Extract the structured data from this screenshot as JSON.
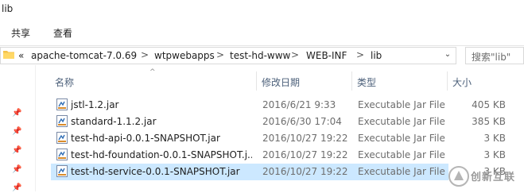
{
  "window": {
    "title": "lib"
  },
  "ribbon": {
    "tabs": [
      "共享",
      "查看"
    ]
  },
  "address": {
    "overflow": "«",
    "crumbs": [
      "apache-tomcat-7.0.69",
      "wtpwebapps",
      "test-hd-www",
      "WEB-INF",
      "lib"
    ],
    "separator": ">"
  },
  "search": {
    "placeholder": "搜索\"lib\""
  },
  "columns": {
    "name": "名称",
    "date": "修改日期",
    "type": "类型",
    "size": "大小"
  },
  "files": [
    {
      "name": "jstl-1.2.jar",
      "date": "2016/6/21 9:33",
      "type": "Executable Jar File",
      "size": "405 KB"
    },
    {
      "name": "standard-1.1.2.jar",
      "date": "2016/6/30 17:04",
      "type": "Executable Jar File",
      "size": "385 KB"
    },
    {
      "name": "test-hd-api-0.0.1-SNAPSHOT.jar",
      "date": "2016/10/27 19:22",
      "type": "Executable Jar File",
      "size": "3 KB"
    },
    {
      "name": "test-hd-foundation-0.0.1-SNAPSHOT.j...",
      "date": "2016/10/27 19:22",
      "type": "Executable Jar File",
      "size": "3 KB"
    },
    {
      "name": "test-hd-service-0.0.1-SNAPSHOT.jar",
      "date": "2016/10/27 19:22",
      "type": "Executable Jar File",
      "size": "3 KB"
    }
  ],
  "selected_row": 4,
  "watermark": {
    "text": "创新互联"
  },
  "colors": {
    "selection": "#cce8ff",
    "header_text": "#4c607a",
    "muted_text": "#6d6d6d"
  }
}
